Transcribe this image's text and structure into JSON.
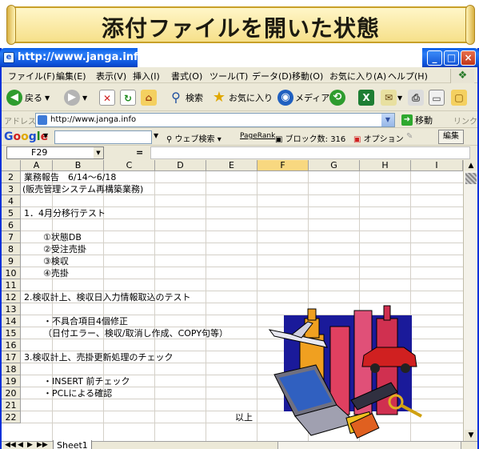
{
  "banner": {
    "title": "添付ファイルを開いた状態"
  },
  "window": {
    "title": "http://www.janga.info",
    "controls": {
      "minimize": "_",
      "maximize": "□",
      "close": "×"
    }
  },
  "menu": [
    "ファイル(F)",
    "編集(E)",
    "表示(V)",
    "挿入(I)",
    "書式(O)",
    "ツール(T)",
    "データ(D)",
    "移動(O)",
    "お気に入り(A)",
    "ヘルプ(H)"
  ],
  "toolbar": {
    "back": "戻る",
    "search": "検索",
    "favorites": "お気に入り",
    "media": "メディア"
  },
  "address": {
    "label": "アドレス(D)",
    "url": "http://www.janga.info",
    "go": "移動",
    "links": "リンク"
  },
  "google": {
    "logo": "Google",
    "web_search": "ウェブ検索",
    "pagerank": "PageRank",
    "blocked": "ブロック数: 316",
    "options": "オプション",
    "edit": "編集"
  },
  "excel": {
    "name_box": "F29",
    "fx": "=",
    "columns": [
      "A",
      "B",
      "C",
      "D",
      "E",
      "F",
      "G",
      "H",
      "I"
    ],
    "active_column": "F",
    "rows": [
      "2",
      "3",
      "4",
      "5",
      "6",
      "7",
      "8",
      "9",
      "10",
      "11",
      "12",
      "13",
      "14",
      "15",
      "16",
      "17",
      "18",
      "19",
      "20",
      "21",
      "22"
    ],
    "cells": {
      "r2": "業務報告　6/14〜6/18",
      "r3": "(販売管理システム再構築業務)",
      "r5": "1．4月分移行テスト",
      "r7": "①状態DB",
      "r8": "②受注売掛",
      "r9": "③検収",
      "r10": "④売掛",
      "r12": "2.検収計上、検収日入力情報取込のテスト",
      "r14": "・不具合項目4個修正",
      "r15": "（日付エラー、検収/取消し作成、COPY句等）",
      "r17": "3.検収計上、売掛更新処理のチェック",
      "r19": "・INSERT 前チェック",
      "r20": "・PCLによる確認",
      "r22": "以上"
    },
    "sheet_tab": "Sheet1",
    "tab_nav": [
      "◀◀",
      "◀",
      "▶",
      "▶▶"
    ]
  }
}
